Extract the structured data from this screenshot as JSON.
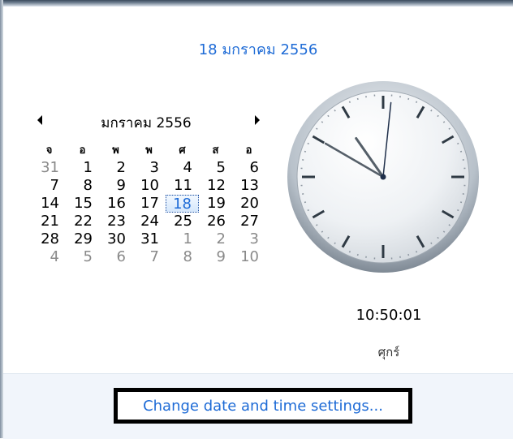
{
  "header": {
    "date_text": "18 มกราคม 2556"
  },
  "calendar": {
    "month_label": "มกราคม 2556",
    "prev_icon": "triangle-left-icon",
    "next_icon": "triangle-right-icon",
    "weekdays": [
      "จ",
      "อ",
      "พ",
      "พ",
      "ศ",
      "ส",
      "อ"
    ],
    "days": [
      {
        "d": "31",
        "m": "prev"
      },
      {
        "d": "1",
        "m": "cur"
      },
      {
        "d": "2",
        "m": "cur"
      },
      {
        "d": "3",
        "m": "cur"
      },
      {
        "d": "4",
        "m": "cur"
      },
      {
        "d": "5",
        "m": "cur"
      },
      {
        "d": "6",
        "m": "cur"
      },
      {
        "d": "7",
        "m": "cur"
      },
      {
        "d": "8",
        "m": "cur"
      },
      {
        "d": "9",
        "m": "cur"
      },
      {
        "d": "10",
        "m": "cur"
      },
      {
        "d": "11",
        "m": "cur"
      },
      {
        "d": "12",
        "m": "cur"
      },
      {
        "d": "13",
        "m": "cur"
      },
      {
        "d": "14",
        "m": "cur"
      },
      {
        "d": "15",
        "m": "cur"
      },
      {
        "d": "16",
        "m": "cur"
      },
      {
        "d": "17",
        "m": "cur"
      },
      {
        "d": "18",
        "m": "today"
      },
      {
        "d": "19",
        "m": "cur"
      },
      {
        "d": "20",
        "m": "cur"
      },
      {
        "d": "21",
        "m": "cur"
      },
      {
        "d": "22",
        "m": "cur"
      },
      {
        "d": "23",
        "m": "cur"
      },
      {
        "d": "24",
        "m": "cur"
      },
      {
        "d": "25",
        "m": "cur"
      },
      {
        "d": "26",
        "m": "cur"
      },
      {
        "d": "27",
        "m": "cur"
      },
      {
        "d": "28",
        "m": "cur"
      },
      {
        "d": "29",
        "m": "cur"
      },
      {
        "d": "30",
        "m": "cur"
      },
      {
        "d": "31",
        "m": "cur"
      },
      {
        "d": "1",
        "m": "next"
      },
      {
        "d": "2",
        "m": "next"
      },
      {
        "d": "3",
        "m": "next"
      },
      {
        "d": "4",
        "m": "next"
      },
      {
        "d": "5",
        "m": "next"
      },
      {
        "d": "6",
        "m": "next"
      },
      {
        "d": "7",
        "m": "next"
      },
      {
        "d": "8",
        "m": "next"
      },
      {
        "d": "9",
        "m": "next"
      },
      {
        "d": "10",
        "m": "next"
      }
    ]
  },
  "clock": {
    "time_text": "10:50:01",
    "weekday_text": "ศุกร์",
    "hours": 10,
    "minutes": 50,
    "seconds": 1
  },
  "footer": {
    "settings_link": "Change date and time settings..."
  },
  "colors": {
    "accent": "#1e6bd6",
    "today_bg": "#d5e7fb",
    "other_month": "#8a8a8a"
  }
}
